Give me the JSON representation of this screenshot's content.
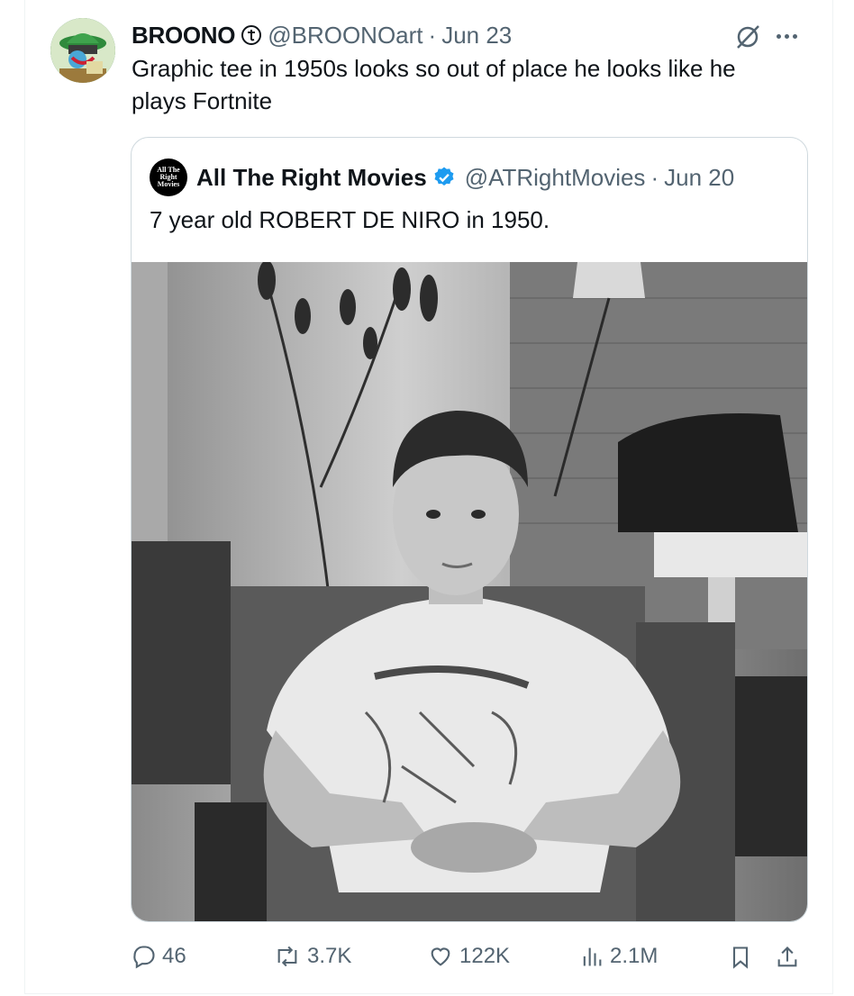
{
  "tweet": {
    "author_name": "BROONO",
    "author_handle": "@BROONOart",
    "separator": "·",
    "date": "Jun 23",
    "text": "Graphic tee in 1950s looks so out of place he looks like he plays Fortnite"
  },
  "quoted_tweet": {
    "avatar_text": [
      "All The",
      "Right",
      "Movies"
    ],
    "author_name": "All The Right Movies",
    "author_handle": "@ATRightMovies",
    "separator": "·",
    "date": "Jun 20",
    "text": "7 year old ROBERT DE NIRO in 1950.",
    "image": "black-and-white photo of a boy in a graphic t-shirt seated in an armchair"
  },
  "actions": {
    "replies": "46",
    "reposts": "3.7K",
    "likes": "122K",
    "views": "2.1M"
  },
  "colors": {
    "text": "#0f1419",
    "secondary": "#536471",
    "border": "#cfd9de",
    "verified": "#1d9bf0"
  },
  "icons": [
    "reply-icon",
    "repost-icon",
    "like-icon",
    "views-icon",
    "bookmark-icon",
    "share-icon",
    "more-icon",
    "grok-icon",
    "verified-icon"
  ]
}
